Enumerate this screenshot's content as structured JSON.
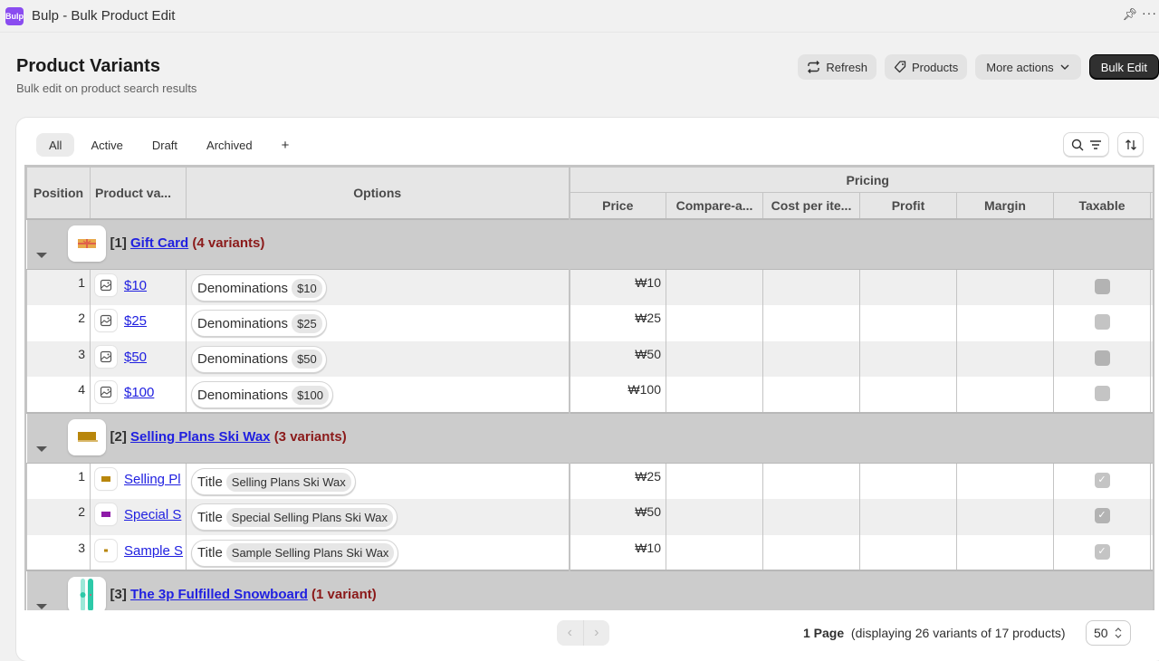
{
  "app": {
    "logo_text": "Bulp",
    "title": "Bulp - Bulk Product Edit",
    "pin_icon": "pin-icon",
    "more_icon": "ellipsis-icon"
  },
  "page": {
    "title": "Product Variants",
    "subtitle": "Bulk edit on product search results"
  },
  "actions": {
    "refresh": "Refresh",
    "products": "Products",
    "more_actions": "More actions",
    "bulk_edit": "Bulk Edit"
  },
  "tabs": [
    {
      "label": "All",
      "active": true
    },
    {
      "label": "Active"
    },
    {
      "label": "Draft"
    },
    {
      "label": "Archived"
    },
    {
      "label": "+"
    }
  ],
  "columns": {
    "position": "Position",
    "product_variant": "Product va...",
    "options": "Options",
    "pricing_group": "Pricing",
    "price": "Price",
    "compare_at": "Compare-a...",
    "cost_per_item": "Cost per ite...",
    "profit": "Profit",
    "margin": "Margin",
    "taxable": "Taxable"
  },
  "groups": [
    {
      "index": "[1]",
      "name": "Gift Card",
      "count": "(4 variants)",
      "variants": [
        {
          "position": "1",
          "name": "$10",
          "option_name": "Denominations",
          "option_value": "$10",
          "price": "₩10",
          "taxable": false
        },
        {
          "position": "2",
          "name": "$25",
          "option_name": "Denominations",
          "option_value": "$25",
          "price": "₩25",
          "taxable": false
        },
        {
          "position": "3",
          "name": "$50",
          "option_name": "Denominations",
          "option_value": "$50",
          "price": "₩50",
          "taxable": false
        },
        {
          "position": "4",
          "name": "$100",
          "option_name": "Denominations",
          "option_value": "$100",
          "price": "₩100",
          "taxable": false
        }
      ]
    },
    {
      "index": "[2]",
      "name": "Selling Plans Ski Wax",
      "count": "(3 variants)",
      "variants": [
        {
          "position": "1",
          "name": "Selling Pl",
          "option_name": "Title",
          "option_value": "Selling Plans Ski Wax",
          "price": "₩25",
          "taxable": true
        },
        {
          "position": "2",
          "name": "Special S",
          "option_name": "Title",
          "option_value": "Special Selling Plans Ski Wax",
          "price": "₩50",
          "taxable": true
        },
        {
          "position": "3",
          "name": "Sample S",
          "option_name": "Title",
          "option_value": "Sample Selling Plans Ski Wax",
          "price": "₩10",
          "taxable": true
        }
      ]
    },
    {
      "index": "[3]",
      "name": "The 3p Fulfilled Snowboard",
      "count": "(1 variant)",
      "variants": []
    }
  ],
  "footer": {
    "pages": "1 Page",
    "info": "(displaying 26 variants of 17 products)",
    "page_size": "50"
  },
  "colors": {
    "accent": "#8a4cf0",
    "link": "#2020e0",
    "count": "#8b1a1a",
    "primary_button": "#303030"
  }
}
